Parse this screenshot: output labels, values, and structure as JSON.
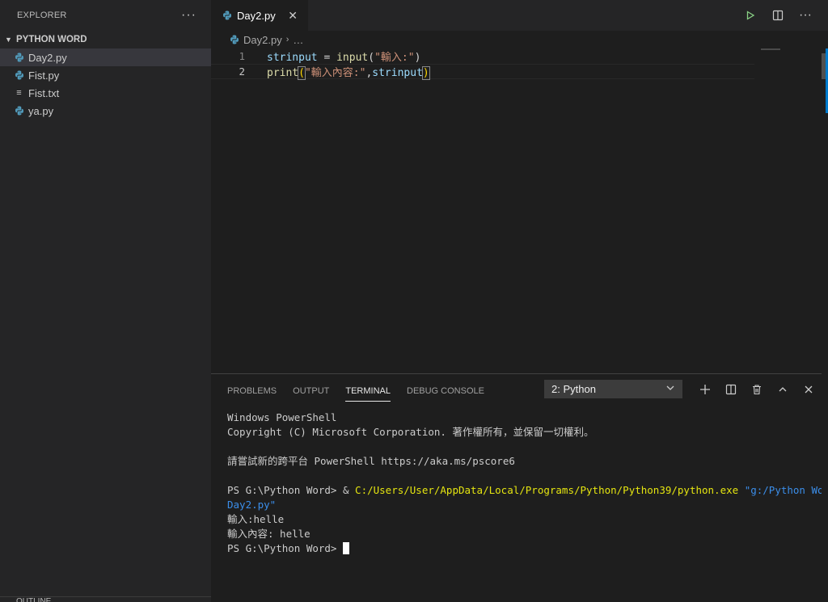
{
  "sidebar": {
    "title": "EXPLORER",
    "more": "···",
    "folder": "PYTHON WORD",
    "files": [
      {
        "name": "Day2.py",
        "icon": "python-icon",
        "active": true
      },
      {
        "name": "Fist.py",
        "icon": "python-icon",
        "active": false
      },
      {
        "name": "Fist.txt",
        "icon": "text-file-icon",
        "active": false
      },
      {
        "name": "ya.py",
        "icon": "python-icon",
        "active": false
      }
    ],
    "outline_label": "OUTLINE"
  },
  "editor": {
    "tab_label": "Day2.py",
    "tab_close": "✕",
    "breadcrumb": {
      "file": "Day2.py",
      "more": "…"
    },
    "lines": [
      {
        "num": "1"
      },
      {
        "num": "2"
      }
    ],
    "code": {
      "l1_var": "strinput",
      "l1_eq": " = ",
      "l1_fn": "input",
      "l1_open": "(",
      "l1_str": "\"輸入:\"",
      "l1_close": ")",
      "l2_fn": "print",
      "l2_open": "(",
      "l2_str": "\"輸入內容:\"",
      "l2_comma": ",",
      "l2_var": "strinput",
      "l2_close": ")"
    }
  },
  "panel": {
    "tabs": [
      "PROBLEMS",
      "OUTPUT",
      "TERMINAL",
      "DEBUG CONSOLE"
    ],
    "active_tab": "TERMINAL",
    "terminal_select": "2: Python",
    "terminal": {
      "l1": "Windows PowerShell",
      "l2": "Copyright (C) Microsoft Corporation. 著作權所有，並保留一切權利。",
      "l3": "請嘗試新的跨平台 PowerShell https://aka.ms/pscore6",
      "l4_prompt": "PS G:\\Python Word> & ",
      "l4_exe": "C:/Users/User/AppData/Local/Programs/Python/Python39/python.exe",
      "l4_arg": " \"g:/Python Word/",
      "l5_arg": "Day2.py\"",
      "l6": "輸入:helle",
      "l7": "輸入內容: helle",
      "l8": "PS G:\\Python Word> "
    }
  },
  "colors": {
    "accent": "#007acc",
    "python_icon": "#519aba",
    "run_icon": "#89d185"
  }
}
